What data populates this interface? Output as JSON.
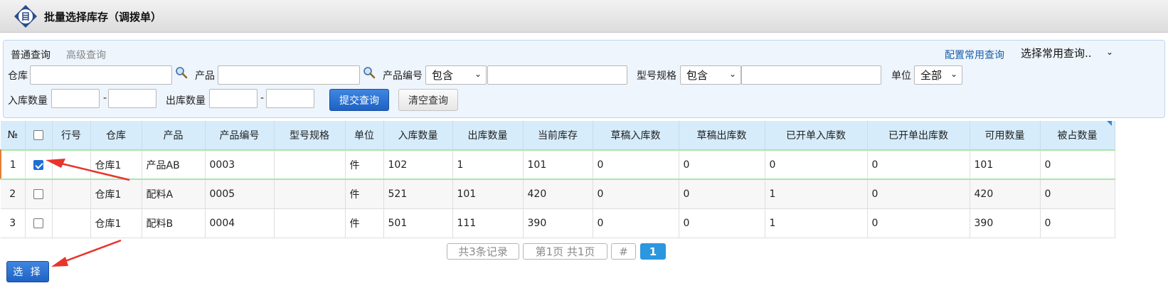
{
  "window": {
    "title": "批量选择库存（调拨单）",
    "logo_glyph": "目"
  },
  "query": {
    "tabs": [
      {
        "label": "普通查询",
        "active": true
      },
      {
        "label": "高级查询",
        "active": false
      }
    ],
    "config_link": "配置常用查询",
    "common_query_select": "选择常用查询..",
    "fields": {
      "warehouse_label": "仓库",
      "warehouse_value": "",
      "product_label": "产品",
      "product_value": "",
      "product_code_label": "产品编号",
      "product_code_op": "包含",
      "product_code_value": "",
      "model_label": "型号规格",
      "model_op": "包含",
      "model_value": "",
      "unit_label": "单位",
      "unit_value": "全部",
      "in_qty_label": "入库数量",
      "in_qty_from": "",
      "in_qty_to": "",
      "out_qty_label": "出库数量",
      "out_qty_from": "",
      "out_qty_to": "",
      "range_sep": "-"
    },
    "submit_label": "提交查询",
    "clear_label": "清空查询"
  },
  "table": {
    "headers": [
      "№",
      "",
      "行号",
      "仓库",
      "产品",
      "产品编号",
      "型号规格",
      "单位",
      "入库数量",
      "出库数量",
      "当前库存",
      "草稿入库数",
      "草稿出库数",
      "已开单入库数",
      "已开单出库数",
      "可用数量",
      "被占数量"
    ],
    "rows": [
      {
        "no": "1",
        "checked": true,
        "line": "",
        "warehouse": "仓库1",
        "product": "产品AB",
        "code": "0003",
        "model": "",
        "unit": "件",
        "in_qty": "102",
        "out_qty": "1",
        "stock": "101",
        "draft_in": "0",
        "draft_out": "0",
        "billed_in": "0",
        "billed_out": "0",
        "available": "101",
        "occupied": "0"
      },
      {
        "no": "2",
        "checked": false,
        "line": "",
        "warehouse": "仓库1",
        "product": "配料A",
        "code": "0005",
        "model": "",
        "unit": "件",
        "in_qty": "521",
        "out_qty": "101",
        "stock": "420",
        "draft_in": "0",
        "draft_out": "0",
        "billed_in": "1",
        "billed_out": "0",
        "available": "420",
        "occupied": "0"
      },
      {
        "no": "3",
        "checked": false,
        "line": "",
        "warehouse": "仓库1",
        "product": "配料B",
        "code": "0004",
        "model": "",
        "unit": "件",
        "in_qty": "501",
        "out_qty": "111",
        "stock": "390",
        "draft_in": "0",
        "draft_out": "0",
        "billed_in": "1",
        "billed_out": "0",
        "available": "390",
        "occupied": "0"
      }
    ]
  },
  "pagination": {
    "total": "共3条记录",
    "page_info": "第1页 共1页",
    "jump": "#",
    "current": "1"
  },
  "choose_button": "选 择",
  "colors": {
    "accent": "#1e62c4",
    "header_bg": "#d6ecfb",
    "annotation_arrow": "#e8342a"
  }
}
